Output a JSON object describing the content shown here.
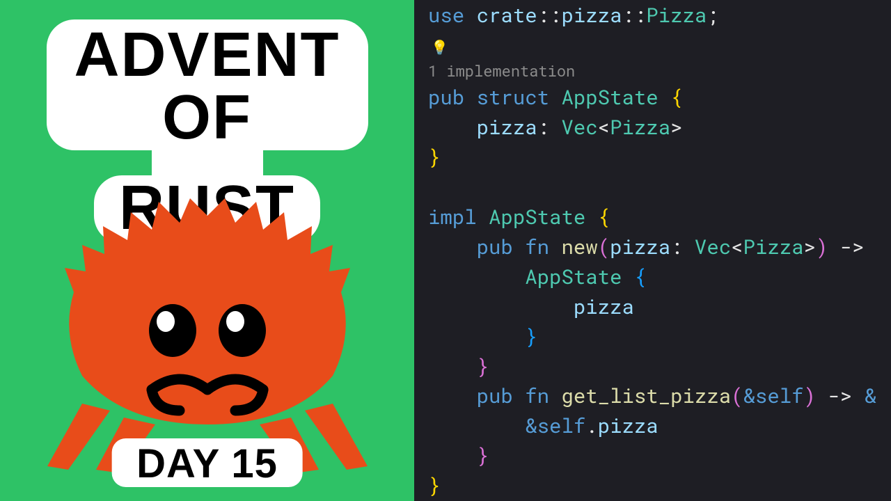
{
  "left": {
    "title_line1": "ADVENT OF",
    "title_line2": "RUST",
    "day_label": "DAY 15"
  },
  "code": {
    "line1_use": "use",
    "line1_crate": "crate",
    "line1_sep1": "::",
    "line1_mod": "pizza",
    "line1_sep2": "::",
    "line1_type": "Pizza",
    "line1_end": ";",
    "codelens": "1 implementation",
    "pub": "pub",
    "struct": "struct",
    "appstate": "AppState",
    "field_pizza": "pizza",
    "colon": ":",
    "vec": "Vec",
    "lt": "<",
    "gt": ">",
    "pizza_type": "Pizza",
    "impl": "impl",
    "fn": "fn",
    "new": "new",
    "lparen": "(",
    "rparen": ")",
    "arrow": " ->",
    "get_list_pizza": "get_list_pizza",
    "amp": "&",
    "self": "self",
    "dot": ".",
    "lbrace": "{",
    "rbrace": "}"
  }
}
